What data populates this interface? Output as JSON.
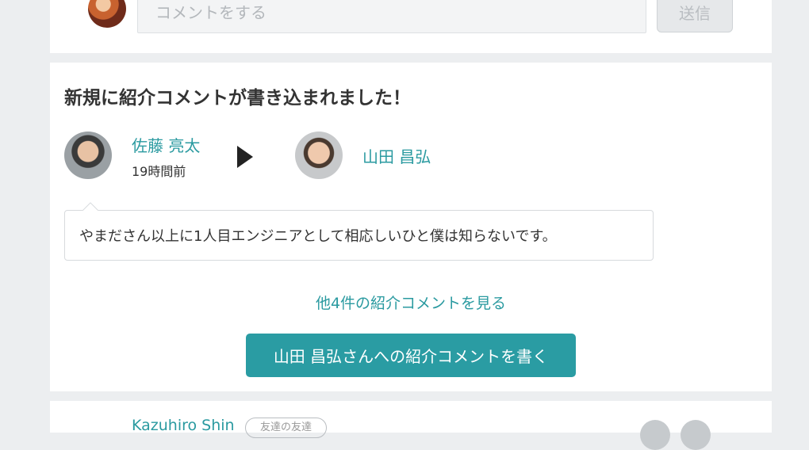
{
  "comment_bar": {
    "placeholder": "コメントをする",
    "send_label": "送信"
  },
  "recommendation": {
    "title": "新規に紹介コメントが書き込まれました！",
    "author": {
      "name": "佐藤 亮太",
      "time": "19時間前"
    },
    "target": {
      "name": "山田 昌弘"
    },
    "comment": "やまださん以上に1人目エンジニアとして相応しいひと僕は知らないです。",
    "more_link": "他4件の紹介コメントを見る",
    "write_button": "山田 昌弘さんへの紹介コメントを書く"
  },
  "next_item": {
    "name": "Kazuhiro Shin",
    "badge": "友達の友達"
  },
  "colors": {
    "accent": "#2a9ca3",
    "link": "#2a9aa0",
    "background": "#eceef0"
  }
}
